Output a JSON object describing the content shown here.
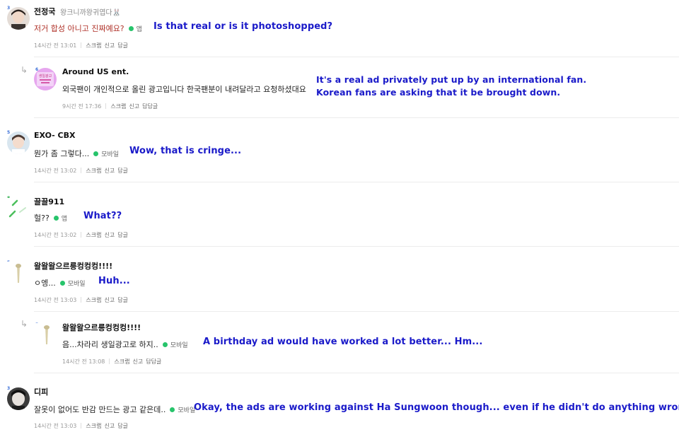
{
  "comments": [
    {
      "nick": "전정국",
      "nick_sub": "왕크니까왕귀엽다🐰",
      "level": "3",
      "text": "저거 합성 아니고 진짜예요?",
      "source": "앱",
      "time": "14시간 전 13:01",
      "actions": [
        "스크랩",
        "신고",
        "답글"
      ],
      "translation": "Is that real or is it photoshopped?"
    },
    {
      "nick": "Around US ent.",
      "level": "6",
      "avatar_text": "생일광고",
      "text": "외국팬이 개인적으로 올린 광고입니다 한국팬분이 내려달라고 요청하셨대요",
      "time": "9시간 전 17:36",
      "actions": [
        "스크랩",
        "신고",
        "답답글"
      ],
      "translation_lines": [
        "It's a real ad privately put up by an international fan.",
        "Korean fans are asking that it be brought down."
      ]
    },
    {
      "nick": "EXO- CBX",
      "level": "5",
      "text": "뭔가 좀 그렇다...",
      "source": "모바일",
      "time": "14시간 전 13:02",
      "actions": [
        "스크랩",
        "신고",
        "답글"
      ],
      "translation": "Wow, that is cringe..."
    },
    {
      "nick": "끌끌911",
      "level": "8",
      "text": "헐??",
      "source": "앱",
      "time": "14시간 전 13:02",
      "actions": [
        "스크랩",
        "신고",
        "답글"
      ],
      "translation": "What??"
    },
    {
      "nick": "왈왈왈으르릉컹컹컹!!!!",
      "level": "5",
      "text": "ㅇ엥...",
      "source": "모바일",
      "time": "14시간 전 13:03",
      "actions": [
        "스크랩",
        "신고",
        "답글"
      ],
      "translation": "Huh..."
    },
    {
      "nick": "왈왈왈으르릉컹컹컹!!!!",
      "level": "5",
      "text": "음...차라리 생일광고로 하지..",
      "source": "모바일",
      "time": "14시간 전 13:08",
      "actions": [
        "스크랩",
        "신고",
        "답답글"
      ],
      "translation": "A birthday ad would have worked a lot better... Hm..."
    },
    {
      "nick": "디피",
      "level": "3",
      "text": "잘못이 없어도 반감 만드는 광고 같은데..",
      "source": "모바일",
      "time": "14시간 전 13:03",
      "actions": [
        "스크랩",
        "신고",
        "답글"
      ],
      "translation": "Okay, the ads are working against Ha Sungwoon though... even if he didn't do anything wrong."
    }
  ],
  "colors": {
    "translation": "#1a1ac9",
    "online_dot": "#27c46b",
    "red_text": "#b0332a"
  },
  "icons": {
    "reply": "reply-arrow-icon",
    "online": "online-dot-icon"
  }
}
